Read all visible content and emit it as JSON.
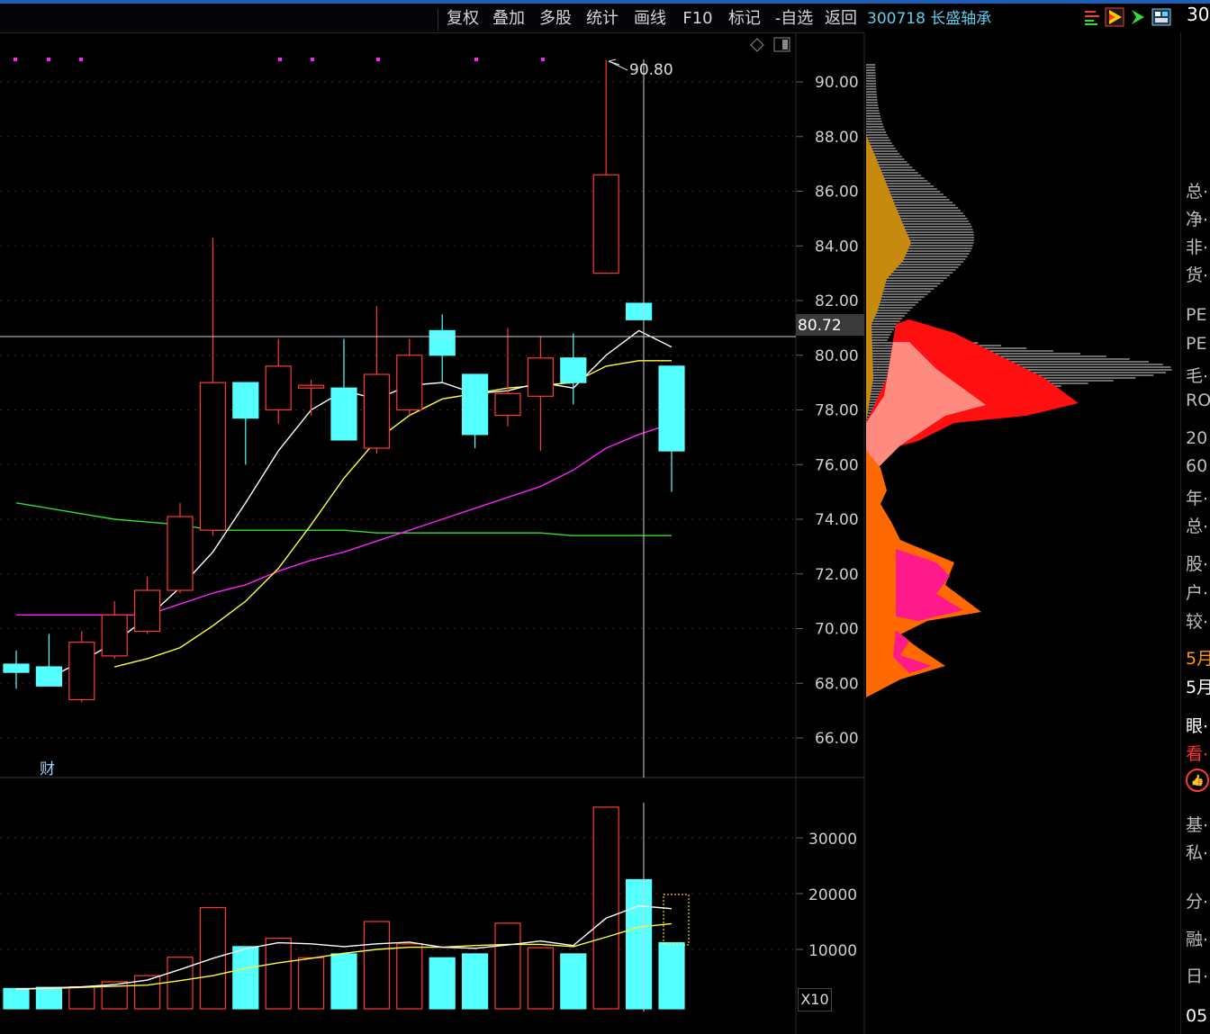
{
  "toolbar": {
    "buttons": [
      "复权",
      "叠加",
      "多股",
      "统计",
      "画线",
      "F10",
      "标记",
      "-自选",
      "返回"
    ]
  },
  "stock": {
    "title": "300718 长盛轴承",
    "title_clip": "30"
  },
  "price_axis": {
    "ticks": [
      "90.00",
      "88.00",
      "86.00",
      "84.00",
      "82.00",
      "80.00",
      "78.00",
      "76.00",
      "74.00",
      "72.00",
      "70.00",
      "68.00",
      "66.00"
    ],
    "crosshair_label": "80.72",
    "high_label": "90.80"
  },
  "volume_axis": {
    "ticks": [
      "30000",
      "20000",
      "10000"
    ],
    "multiplier": "X10"
  },
  "markers": {
    "cai": "财"
  },
  "side_panel": {
    "items": [
      "总⋯",
      "净⋯",
      "非⋯",
      "货⋯",
      "PE",
      "PE",
      "毛⋯",
      "RO",
      "20",
      "60",
      "年⋯",
      "总⋯",
      "股⋯",
      "户⋯",
      "较⋯",
      "5月",
      "5月",
      "眼⋯",
      "看⋯",
      "基⋯",
      "私⋯",
      "分⋯",
      "融⋯",
      "日⋯",
      "05"
    ]
  },
  "colors": {
    "up": "#ff3b30",
    "down": "#54ffff",
    "ma5": "#ffffff",
    "ma10": "#ffff3c",
    "ma20": "#ff22ff",
    "ma60": "#33dd33",
    "background": "#000000"
  },
  "chart_data": {
    "type": "candlestick",
    "price_range": [
      65,
      91.5
    ],
    "volume_range": [
      0,
      36000
    ],
    "candles": [
      {
        "o": 68.7,
        "c": 68.4,
        "h": 69.2,
        "l": 67.8
      },
      {
        "o": 68.6,
        "c": 67.9,
        "h": 69.8,
        "l": 67.9
      },
      {
        "o": 67.4,
        "c": 69.5,
        "h": 69.9,
        "l": 67.3
      },
      {
        "o": 69.0,
        "c": 70.5,
        "h": 71.0,
        "l": 68.9
      },
      {
        "o": 69.9,
        "c": 71.4,
        "h": 71.9,
        "l": 69.8
      },
      {
        "o": 71.4,
        "c": 74.1,
        "h": 74.6,
        "l": 71.3
      },
      {
        "o": 73.6,
        "c": 79.0,
        "h": 84.3,
        "l": 73.4
      },
      {
        "o": 79.0,
        "c": 77.7,
        "h": 79.0,
        "l": 76.0
      },
      {
        "o": 78.0,
        "c": 79.6,
        "h": 80.6,
        "l": 77.5
      },
      {
        "o": 78.8,
        "c": 78.9,
        "h": 79.1,
        "l": 77.8
      },
      {
        "o": 78.8,
        "c": 76.9,
        "h": 80.6,
        "l": 76.9
      },
      {
        "o": 76.6,
        "c": 79.3,
        "h": 81.8,
        "l": 76.4
      },
      {
        "o": 78.0,
        "c": 80.0,
        "h": 80.6,
        "l": 77.8
      },
      {
        "o": 80.9,
        "c": 80.0,
        "h": 81.5,
        "l": 79.0
      },
      {
        "o": 79.3,
        "c": 77.1,
        "h": 79.3,
        "l": 76.6
      },
      {
        "o": 77.8,
        "c": 78.6,
        "h": 81.0,
        "l": 77.4
      },
      {
        "o": 78.5,
        "c": 79.9,
        "h": 80.7,
        "l": 76.5
      },
      {
        "o": 79.9,
        "c": 79.0,
        "h": 80.8,
        "l": 78.2
      },
      {
        "o": 83.0,
        "c": 86.6,
        "h": 90.8,
        "l": 83.0
      },
      {
        "o": 81.9,
        "c": 81.3,
        "h": 81.9,
        "l": 81.3
      },
      {
        "o": 79.6,
        "c": 76.5,
        "h": 79.6,
        "l": 75.0
      }
    ],
    "ma5": [
      68.2,
      68.8,
      69.5,
      70.4,
      71.5,
      72.8,
      74.6,
      76.5,
      78.0,
      78.7,
      78.4,
      78.9,
      79.0,
      78.6,
      78.7,
      79.0,
      78.8,
      80.0,
      80.9,
      80.3
    ],
    "ma10": [
      68.6,
      68.9,
      69.3,
      70.1,
      71.0,
      72.2,
      73.8,
      75.5,
      76.9,
      77.8,
      78.4,
      78.6,
      78.8,
      78.9,
      79.0,
      79.6,
      79.8,
      79.8
    ],
    "ma20": [
      70.5,
      70.5,
      70.5,
      70.5,
      70.5,
      70.9,
      71.3,
      71.6,
      72.1,
      72.5,
      72.8,
      73.2,
      73.6,
      74.0,
      74.4,
      74.8,
      75.2,
      75.8,
      76.6,
      77.1,
      77.5
    ],
    "ma60": [
      74.6,
      74.4,
      74.2,
      74.0,
      73.9,
      73.8,
      73.6,
      73.6,
      73.6,
      73.6,
      73.6,
      73.5,
      73.5,
      73.5,
      73.5,
      73.5,
      73.5,
      73.4,
      73.4,
      73.4,
      73.4
    ],
    "volume": [
      3000,
      3200,
      3300,
      4200,
      5300,
      8600,
      17500,
      10500,
      12000,
      8500,
      9200,
      15000,
      11000,
      8500,
      9200,
      14700,
      10300,
      9200,
      35500,
      22500,
      11200
    ],
    "vol_ma5": [
      2900,
      3100,
      3300,
      3700,
      4500,
      6400,
      8400,
      10100,
      11200,
      11000,
      10500,
      11000,
      11300,
      10400,
      10200,
      10800,
      11500,
      10700,
      15600,
      17800,
      17300
    ],
    "vol_ma10": [
      2900,
      3000,
      3200,
      3400,
      3600,
      4400,
      5300,
      6600,
      7600,
      8400,
      9300,
      10000,
      10400,
      10400,
      10700,
      10900,
      10900,
      10500,
      12200,
      14000,
      14600
    ]
  }
}
